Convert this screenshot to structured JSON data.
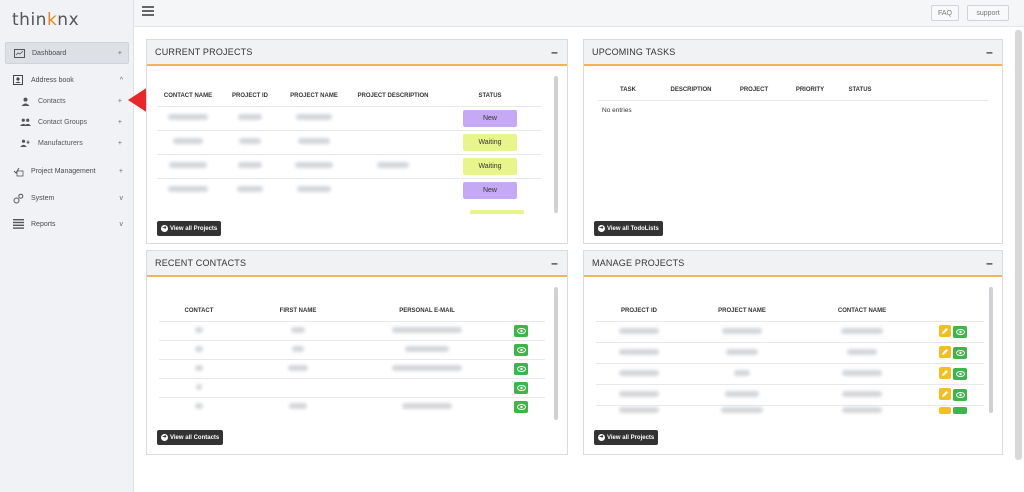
{
  "app": {
    "logo_prefix": "thin",
    "logo_k": "k",
    "logo_suffix": "nx"
  },
  "topbar": {
    "faq_label": "FAQ",
    "support_label": "support"
  },
  "sidebar": {
    "dashboard": "Dashboard",
    "address_book": "Address book",
    "contacts": "Contacts",
    "contact_groups": "Contact Groups",
    "manufacturers": "Manufacturers",
    "project_management": "Project Management",
    "system": "System",
    "reports": "Reports"
  },
  "current_projects": {
    "title": "CURRENT PROJECTS",
    "headers": [
      "CONTACT NAME",
      "PROJECT ID",
      "PROJECT NAME",
      "PROJECT DESCRIPTION",
      "STATUS"
    ],
    "rows": [
      {
        "status": "New"
      },
      {
        "status": "Waiting"
      },
      {
        "status": "Waiting"
      },
      {
        "status": "New"
      }
    ],
    "view_all": "View all Projects"
  },
  "upcoming_tasks": {
    "title": "UPCOMING TASKS",
    "headers": [
      "TASK",
      "DESCRIPTION",
      "PROJECT",
      "PRIORITY",
      "STATUS"
    ],
    "empty": "No entries",
    "view_all": "View all TodoLists"
  },
  "recent_contacts": {
    "title": "RECENT CONTACTS",
    "headers": [
      "CONTACT",
      "FIRST NAME",
      "PERSONAL E-MAIL"
    ],
    "row_count": 5,
    "view_all": "View all Contacts"
  },
  "manage_projects": {
    "title": "MANAGE PROJECTS",
    "headers": [
      "PROJECT ID",
      "PROJECT NAME",
      "CONTACT NAME"
    ],
    "row_count": 5,
    "view_all": "View all Projects"
  },
  "colors": {
    "accent": "#f2b45a",
    "new": "#c5a9f5",
    "waiting": "#e8f58a",
    "view_green": "#3cb54a",
    "edit_yellow": "#f0c020",
    "arrow_red": "#e8262b"
  }
}
